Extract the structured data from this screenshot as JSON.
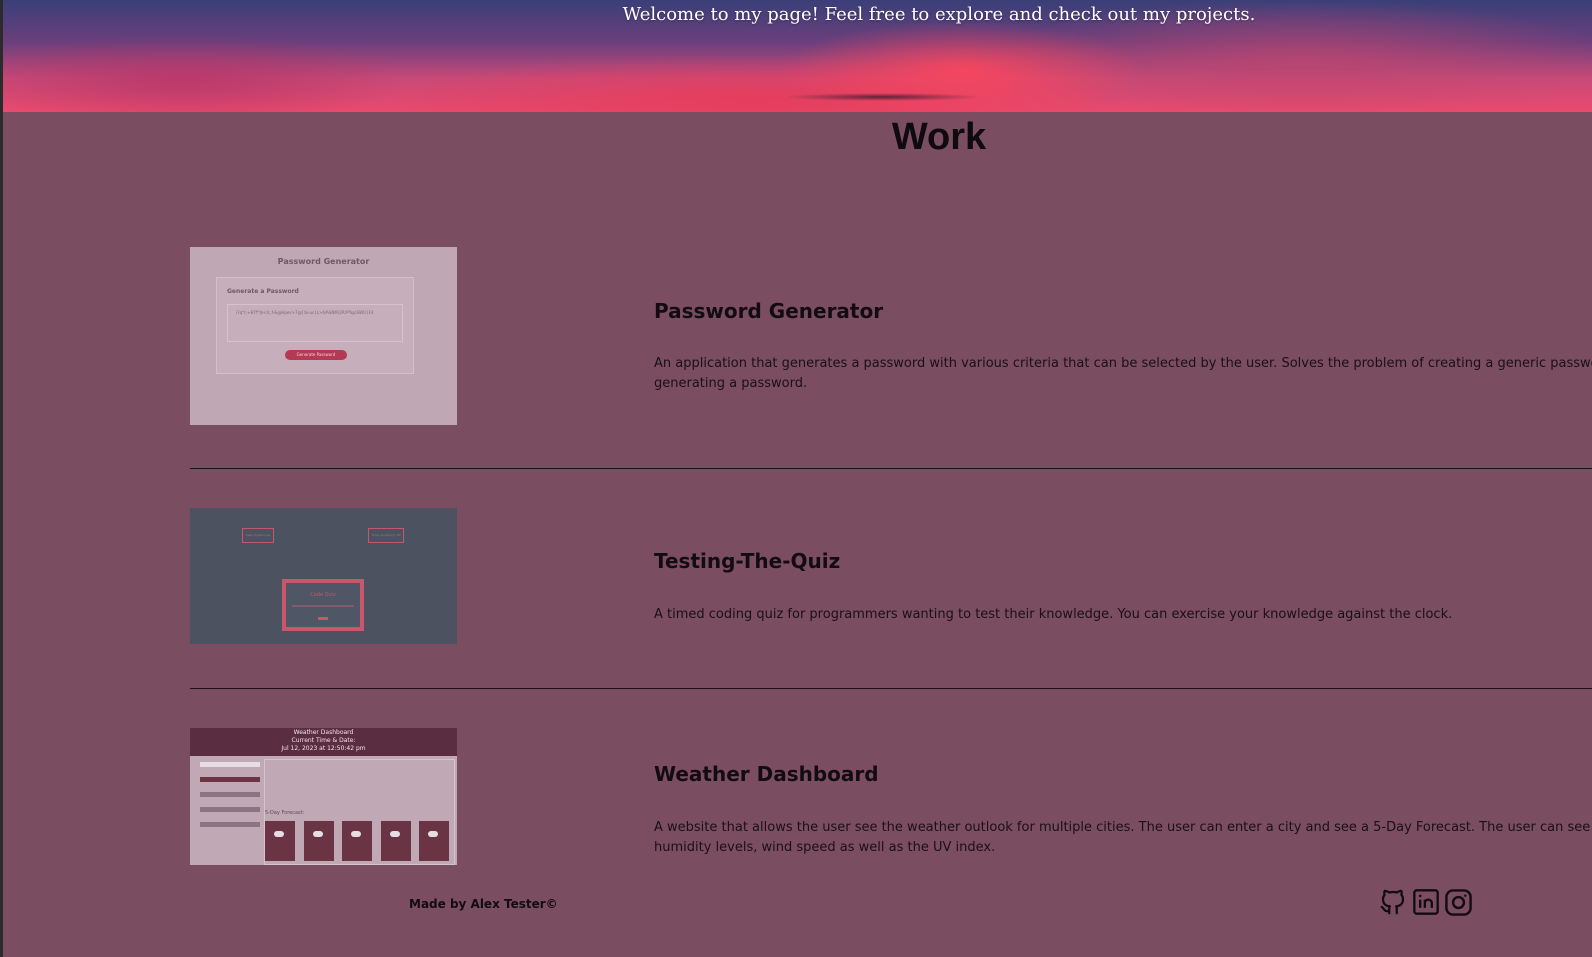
{
  "header": {
    "welcome_text": "Welcome to my page! Feel free to explore and check out my projects."
  },
  "work": {
    "title": "Work",
    "projects": [
      {
        "title": "Password Generator",
        "description_line1": "An application that generates a password with various criteria that can be selected by the user. Solves the problem of creating a generic password",
        "description_line2": "generating a password.",
        "thumb": {
          "header": "Password Generator",
          "card_title": "Generate a Password",
          "password": "i7q*(:+87f*]$<4:,f-&@Hpev>7@] bi-uc{L>6#&NMi]/RrP%p)SWU}Fd",
          "button": "Generate Password"
        }
      },
      {
        "title": "Testing-The-Quiz",
        "description_line1": "A timed coding quiz for programmers wanting to test their knowledge. You can exercise your knowledge against the clock.",
        "thumb": {
          "left_button": "View Highscores",
          "right_button": "Time remaining: 60",
          "quiz_title": "Code Quiz"
        }
      },
      {
        "title": "Weather Dashboard",
        "description_line1": "A website that allows the user see the weather outlook for multiple cities. The user can enter a city and see a 5-Day Forecast. The user can see the t",
        "description_line2": "humidity levels, wind speed as well as the UV index.",
        "thumb": {
          "title": "Weather Dashboard",
          "subtitle": "Current Time & Date:",
          "datetime": "Jul 12, 2023 at 12:50:42 pm",
          "forecast_label": "5-Day Forecast:"
        }
      }
    ]
  },
  "footer": {
    "made_by": "Made by Alex Tester©",
    "socials": [
      {
        "name": "github-icon"
      },
      {
        "name": "linkedin-icon"
      },
      {
        "name": "instagram-icon"
      }
    ]
  },
  "colors": {
    "background": "#7a4d60",
    "text": "#120c10",
    "accent": "#b33a52"
  }
}
